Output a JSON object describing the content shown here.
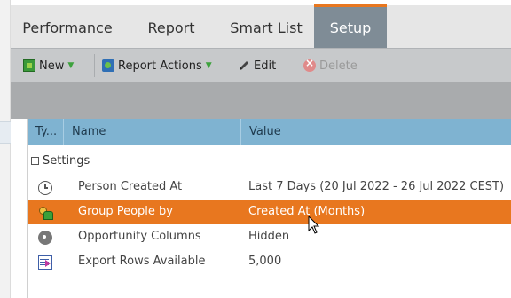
{
  "tabs": [
    {
      "label": "Performance",
      "selected": false
    },
    {
      "label": "Report",
      "selected": false
    },
    {
      "label": "Smart List",
      "selected": false
    },
    {
      "label": "Setup",
      "selected": true
    }
  ],
  "toolbar": {
    "new_label": "New",
    "report_actions_label": "Report Actions",
    "edit_label": "Edit",
    "delete_label": "Delete"
  },
  "grid": {
    "columns": [
      "Ty...",
      "Name",
      "Value"
    ],
    "group_label": "Settings",
    "rows": [
      {
        "icon": "clock-icon",
        "name": "Person Created At",
        "value": "Last 7 Days (20 Jul 2022 - 26 Jul 2022 CEST)",
        "selected": false
      },
      {
        "icon": "people-icon",
        "name": "Group People by",
        "value": "Created At (Months)",
        "selected": true
      },
      {
        "icon": "gear-icon",
        "name": "Opportunity Columns",
        "value": "Hidden",
        "selected": false
      },
      {
        "icon": "export-icon",
        "name": "Export Rows Available",
        "value": "5,000",
        "selected": false
      }
    ]
  },
  "colors": {
    "accent": "#e8771f",
    "selected_tab_bg": "#7f8c96",
    "grid_header_bg": "#7fb3d1",
    "toolbar_bg": "#c7c9cb"
  }
}
